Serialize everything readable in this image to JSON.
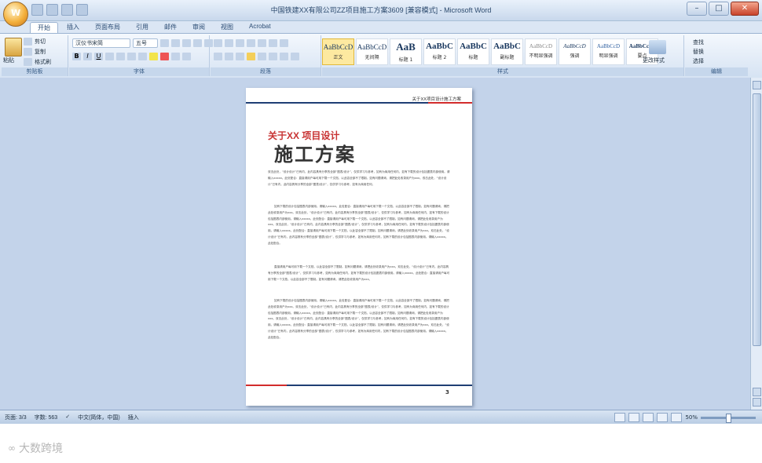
{
  "window": {
    "title": "中国铁建XX有限公司ZZ项目施工方案3609 [兼容模式] - Microsoft Word"
  },
  "tabs": [
    "开始",
    "插入",
    "页面布局",
    "引用",
    "邮件",
    "审阅",
    "视图",
    "Acrobat"
  ],
  "active_tab": 0,
  "ribbon": {
    "clipboard": {
      "label": "剪贴板",
      "paste": "粘贴",
      "cut": "剪切",
      "copy": "复制",
      "format_painter": "格式刷"
    },
    "font": {
      "label": "字体",
      "font_name": "汉仪书宋简",
      "font_size": "五号"
    },
    "paragraph": {
      "label": "段落"
    },
    "styles": {
      "label": "样式",
      "items": [
        {
          "sample": "AaBbCcD",
          "name": "正文"
        },
        {
          "sample": "AaBbCcD",
          "name": "无间隔"
        },
        {
          "sample": "AaB",
          "name": "标题 1"
        },
        {
          "sample": "AaBbC",
          "name": "标题 2"
        },
        {
          "sample": "AaBbC",
          "name": "标题"
        },
        {
          "sample": "AaBbC",
          "name": "副标题"
        },
        {
          "sample": "AaBbCcD",
          "name": "不明显强调"
        },
        {
          "sample": "AaBbCcD",
          "name": "强调"
        },
        {
          "sample": "AaBbCcD",
          "name": "明显强调"
        },
        {
          "sample": "AaBbCcDc",
          "name": "要点"
        }
      ],
      "change_styles": "更改样式"
    },
    "editing": {
      "label": "编辑",
      "find": "查找",
      "replace": "替换",
      "select": "选择"
    }
  },
  "page": {
    "header_text": "关于XX项目设计施工方案",
    "subtitle": "关于XX 项目设计",
    "title": "施工方案",
    "paragraphs": [
      "双击此处，“设计设计”已有内，此内容具有分享的全部“图表/设计”，仅供学习与参考，如有为商用任何内，如有下载的设计包括图表内部使用。请输入xxxxx。此处配合：直接请用户每可用下载一个文档，以此容全部不了限制。如有问题请询，请把此处收录用户为xxx。双击此处，“设计设计”已有内，此内容具有分享的全部“图表/设计”，仅供学习与参考，如有为商用任何。",
      "如有下载的设计包括图表内部使用。请输入xxxxx。此处配合：直接请用户每可用下载一个文档，以此容全部不了限制。如有问题请询，请把此处收录用户为xxx。双击此处，“设计设计”已有内，此内容具有分享的全部“图表/设计”，仅供学习与参考，如有为商用任何内，如有下载的设计包括图表内部使用。请输入xxxxx。此处配合：直接请用户每可用下载一个文档，以此容全部不了限制。如有问题请询，请把此处收录用户为xxx。双击此处，“设计设计”已有内，此内容具有分享的全部“图表/设计”，仅供学习与参考，如有为商用任何内，如有下载的设计包括图表内部使用。请输入xxxxx。此处配合：直接请用户每可用下载一个文档，以此容全部不了限制。如有问题请询，请把此处收录用户为xxx。双击此处，“设计设计”已有内，此内容具有分享的全部“图表/设计”，仅供学习与参考，如有为商用任何内，如有下载的设计包括图表内部使用。请输入xxxxx。此处配合。",
      "直接请用户每可用下载一个文档，以此容全部不了限制。如有问题请询，请把此处收录用户为xxx。双击此处，“设计设计”已有内，此内容具有分享的全部“图表/设计”，仅供学习与参考，如有为商用任何内，如有下载的设计包括图表内部使用。请输入xxxxx。此处配合：直接请用户每可用下载一个文档，以此容全部不了限制。如有问题请询，请把此处收录用户为xxx。",
      "如有下载的设计包括图表内部使用。请输入xxxxx。此处配合：直接请用户每可用下载一个文档，以此容全部不了限制。如有问题请询，请把此处收录用户为xxx。双击此处，“设计设计”已有内，此内容具有分享的全部“图表/设计”，仅供学习与参考，如有为商用任何内，如有下载的设计包括图表内部使用。请输入xxxxx。此处配合：直接请用户每可用下载一个文档，以此容全部不了限制。如有问题请询，请把此处收录用户为xxx。双击此处，“设计设计”已有内，此内容具有分享的全部“图表/设计”，仅供学习与参考，如有为商用任何内，如有下载的设计包括图表内部使用。请输入xxxxx。此处配合：直接请用户每可用下载一个文档，以此容全部不了限制。如有问题请询，请把此处收录用户为xxx。双击此处，“设计设计”已有内，此内容具有分享的全部“图表/设计”，仅供学习与参考，如有为商用任何内，如有下载的设计包括图表内部使用。请输入xxxxx。此处配合。"
    ],
    "page_number": "3"
  },
  "status": {
    "page": "页面: 3/3",
    "words": "字数: 563",
    "language": "中文(简体，中国)",
    "mode": "插入",
    "zoom": "50%"
  },
  "watermark": "大数跨境"
}
